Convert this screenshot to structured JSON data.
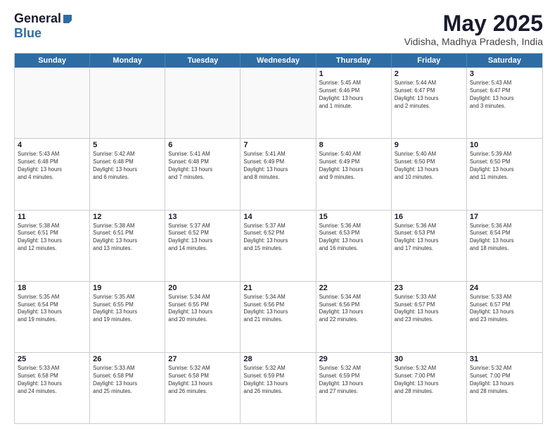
{
  "logo": {
    "general": "General",
    "blue": "Blue"
  },
  "title": {
    "month_year": "May 2025",
    "location": "Vidisha, Madhya Pradesh, India"
  },
  "header_days": [
    "Sunday",
    "Monday",
    "Tuesday",
    "Wednesday",
    "Thursday",
    "Friday",
    "Saturday"
  ],
  "weeks": [
    [
      {
        "day": "",
        "text": ""
      },
      {
        "day": "",
        "text": ""
      },
      {
        "day": "",
        "text": ""
      },
      {
        "day": "",
        "text": ""
      },
      {
        "day": "1",
        "text": "Sunrise: 5:45 AM\nSunset: 6:46 PM\nDaylight: 13 hours\nand 1 minute."
      },
      {
        "day": "2",
        "text": "Sunrise: 5:44 AM\nSunset: 6:47 PM\nDaylight: 13 hours\nand 2 minutes."
      },
      {
        "day": "3",
        "text": "Sunrise: 5:43 AM\nSunset: 6:47 PM\nDaylight: 13 hours\nand 3 minutes."
      }
    ],
    [
      {
        "day": "4",
        "text": "Sunrise: 5:43 AM\nSunset: 6:48 PM\nDaylight: 13 hours\nand 4 minutes."
      },
      {
        "day": "5",
        "text": "Sunrise: 5:42 AM\nSunset: 6:48 PM\nDaylight: 13 hours\nand 6 minutes."
      },
      {
        "day": "6",
        "text": "Sunrise: 5:41 AM\nSunset: 6:48 PM\nDaylight: 13 hours\nand 7 minutes."
      },
      {
        "day": "7",
        "text": "Sunrise: 5:41 AM\nSunset: 6:49 PM\nDaylight: 13 hours\nand 8 minutes."
      },
      {
        "day": "8",
        "text": "Sunrise: 5:40 AM\nSunset: 6:49 PM\nDaylight: 13 hours\nand 9 minutes."
      },
      {
        "day": "9",
        "text": "Sunrise: 5:40 AM\nSunset: 6:50 PM\nDaylight: 13 hours\nand 10 minutes."
      },
      {
        "day": "10",
        "text": "Sunrise: 5:39 AM\nSunset: 6:50 PM\nDaylight: 13 hours\nand 11 minutes."
      }
    ],
    [
      {
        "day": "11",
        "text": "Sunrise: 5:38 AM\nSunset: 6:51 PM\nDaylight: 13 hours\nand 12 minutes."
      },
      {
        "day": "12",
        "text": "Sunrise: 5:38 AM\nSunset: 6:51 PM\nDaylight: 13 hours\nand 13 minutes."
      },
      {
        "day": "13",
        "text": "Sunrise: 5:37 AM\nSunset: 6:52 PM\nDaylight: 13 hours\nand 14 minutes."
      },
      {
        "day": "14",
        "text": "Sunrise: 5:37 AM\nSunset: 6:52 PM\nDaylight: 13 hours\nand 15 minutes."
      },
      {
        "day": "15",
        "text": "Sunrise: 5:36 AM\nSunset: 6:53 PM\nDaylight: 13 hours\nand 16 minutes."
      },
      {
        "day": "16",
        "text": "Sunrise: 5:36 AM\nSunset: 6:53 PM\nDaylight: 13 hours\nand 17 minutes."
      },
      {
        "day": "17",
        "text": "Sunrise: 5:36 AM\nSunset: 6:54 PM\nDaylight: 13 hours\nand 18 minutes."
      }
    ],
    [
      {
        "day": "18",
        "text": "Sunrise: 5:35 AM\nSunset: 6:54 PM\nDaylight: 13 hours\nand 19 minutes."
      },
      {
        "day": "19",
        "text": "Sunrise: 5:35 AM\nSunset: 6:55 PM\nDaylight: 13 hours\nand 19 minutes."
      },
      {
        "day": "20",
        "text": "Sunrise: 5:34 AM\nSunset: 6:55 PM\nDaylight: 13 hours\nand 20 minutes."
      },
      {
        "day": "21",
        "text": "Sunrise: 5:34 AM\nSunset: 6:56 PM\nDaylight: 13 hours\nand 21 minutes."
      },
      {
        "day": "22",
        "text": "Sunrise: 5:34 AM\nSunset: 6:56 PM\nDaylight: 13 hours\nand 22 minutes."
      },
      {
        "day": "23",
        "text": "Sunrise: 5:33 AM\nSunset: 6:57 PM\nDaylight: 13 hours\nand 23 minutes."
      },
      {
        "day": "24",
        "text": "Sunrise: 5:33 AM\nSunset: 6:57 PM\nDaylight: 13 hours\nand 23 minutes."
      }
    ],
    [
      {
        "day": "25",
        "text": "Sunrise: 5:33 AM\nSunset: 6:58 PM\nDaylight: 13 hours\nand 24 minutes."
      },
      {
        "day": "26",
        "text": "Sunrise: 5:33 AM\nSunset: 6:58 PM\nDaylight: 13 hours\nand 25 minutes."
      },
      {
        "day": "27",
        "text": "Sunrise: 5:32 AM\nSunset: 6:58 PM\nDaylight: 13 hours\nand 26 minutes."
      },
      {
        "day": "28",
        "text": "Sunrise: 5:32 AM\nSunset: 6:59 PM\nDaylight: 13 hours\nand 26 minutes."
      },
      {
        "day": "29",
        "text": "Sunrise: 5:32 AM\nSunset: 6:59 PM\nDaylight: 13 hours\nand 27 minutes."
      },
      {
        "day": "30",
        "text": "Sunrise: 5:32 AM\nSunset: 7:00 PM\nDaylight: 13 hours\nand 28 minutes."
      },
      {
        "day": "31",
        "text": "Sunrise: 5:32 AM\nSunset: 7:00 PM\nDaylight: 13 hours\nand 28 minutes."
      }
    ]
  ]
}
